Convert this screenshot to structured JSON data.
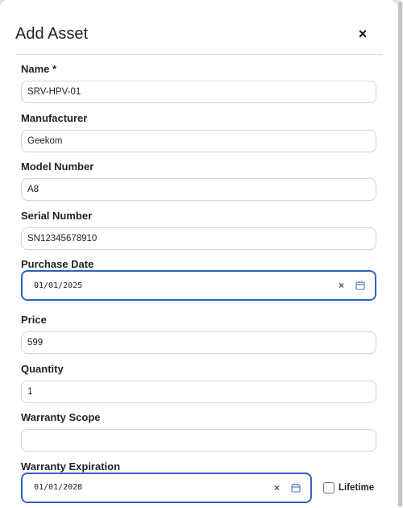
{
  "modal": {
    "title": "Add Asset",
    "close_symbol": "×"
  },
  "fields": {
    "name": {
      "label": "Name *",
      "value": "SRV-HPV-01"
    },
    "manufacturer": {
      "label": "Manufacturer",
      "value": "Geekom"
    },
    "model_number": {
      "label": "Model Number",
      "value": "A8"
    },
    "serial_number": {
      "label": "Serial Number",
      "value": "SN12345678910"
    },
    "purchase_date": {
      "label": "Purchase Date",
      "value": "01/01/2025",
      "clear_symbol": "×",
      "icon": "calendar-icon"
    },
    "price": {
      "label": "Price",
      "value": "599"
    },
    "quantity": {
      "label": "Quantity",
      "value": "1"
    },
    "warranty_scope": {
      "label": "Warranty Scope",
      "value": ""
    },
    "warranty_expiration": {
      "label": "Warranty Expiration",
      "value": "01/01/2028",
      "clear_symbol": "×",
      "icon": "calendar-icon"
    },
    "lifetime": {
      "label": "Lifetime",
      "checked": false
    }
  },
  "colors": {
    "focus_border": "#2e62c9",
    "input_border": "#ced4da",
    "calendar_icon": "#4a72c9"
  }
}
